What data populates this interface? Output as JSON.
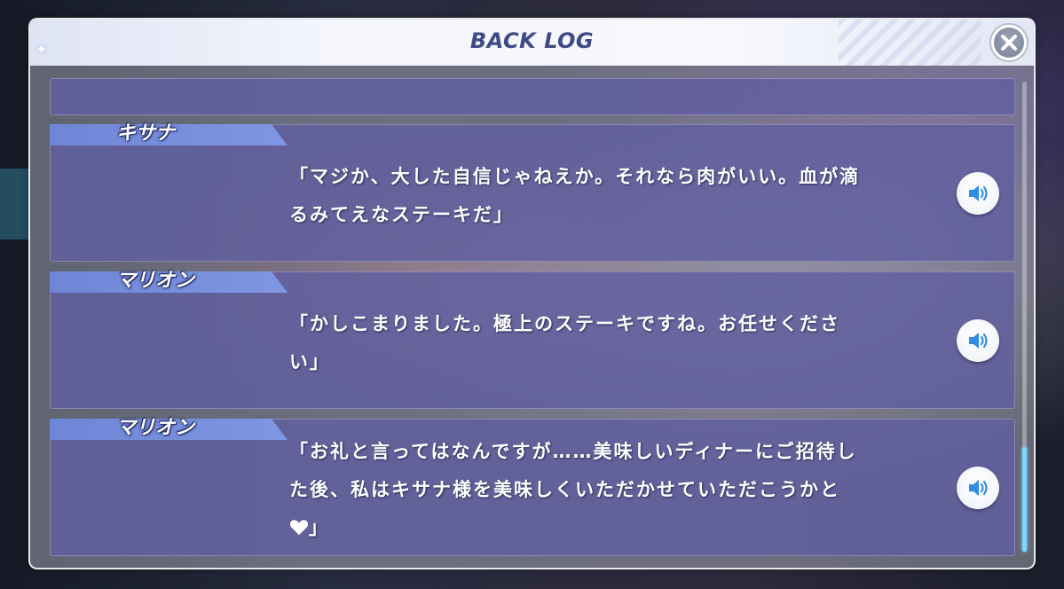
{
  "window": {
    "title": "BACK LOG"
  },
  "icons": {
    "close": "close-icon",
    "voice": "speaker-icon",
    "title_decoration": "sparkle-icon"
  },
  "colors": {
    "title_text": "#3d4a86",
    "entry_bg": "#605ea0",
    "name_tag": "#7f96e2",
    "scroll_thumb": "#7ed6ff"
  },
  "log": {
    "entries": [
      {
        "speaker": "キサナ",
        "line1": "「マジか、大した自信じゃねえか。それなら肉がいい。血が滴",
        "line2": "るみてえなステーキだ」",
        "line3": ""
      },
      {
        "speaker": "マリオン",
        "line1": "「かしこまりました。極上のステーキですね。お任せくださ",
        "line2": "い」",
        "line3": ""
      },
      {
        "speaker": "マリオン",
        "line1": "「お礼と言ってはなんですが……美味しいディナーにご招待し",
        "line2": "た後、私はキサナ様を美味しくいただかせていただこうかと",
        "line3": "」"
      }
    ]
  }
}
